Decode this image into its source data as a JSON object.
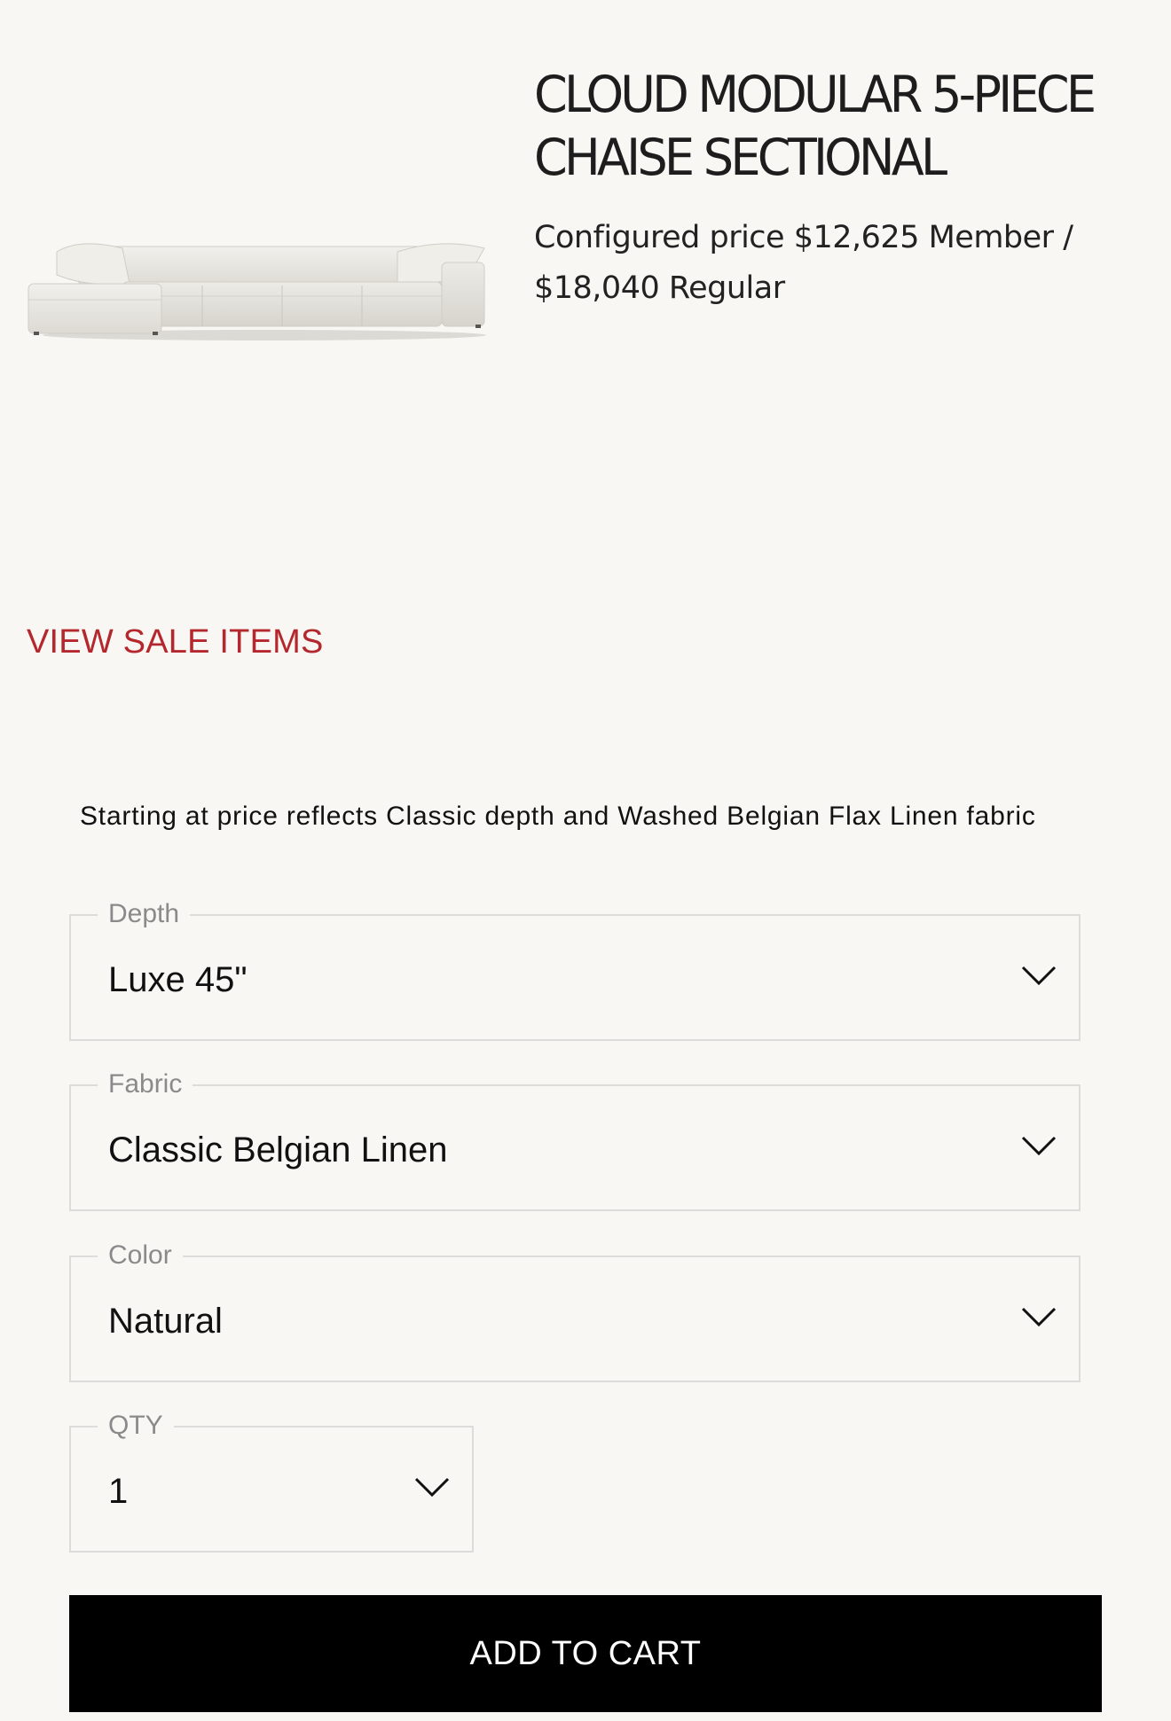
{
  "product": {
    "title": "CLOUD MODULAR 5-PIECE CHAISE SECTIONAL",
    "price_prefix": "Configured price",
    "member_price": "$12,625",
    "member_label": "Member /",
    "regular_price": "$18,040",
    "regular_label": "Regular"
  },
  "sale_link": "VIEW SALE ITEMS",
  "note": "Starting at price reflects Classic depth and Washed Belgian Flax Linen fabric",
  "fields": {
    "depth": {
      "label": "Depth",
      "value": "Luxe 45\""
    },
    "fabric": {
      "label": "Fabric",
      "value": "Classic Belgian Linen"
    },
    "color": {
      "label": "Color",
      "value": "Natural"
    },
    "qty": {
      "label": "QTY",
      "value": "1"
    }
  },
  "cta": {
    "add_to_cart": "ADD TO CART"
  },
  "icons": {
    "dropdown": "chevron-down-icon",
    "image": "sectional-sofa-image"
  },
  "colors": {
    "sale": "#b4272c",
    "cta_bg": "#000000",
    "background": "#f8f7f4"
  }
}
